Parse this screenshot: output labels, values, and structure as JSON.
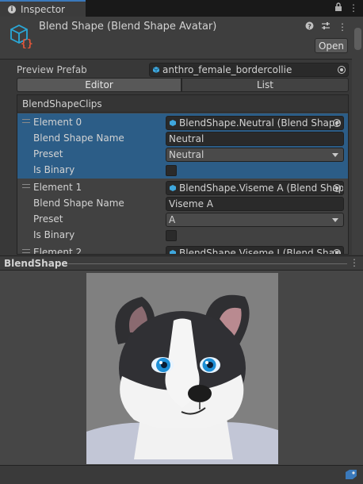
{
  "tab": {
    "label": "Inspector",
    "icon": "info-icon"
  },
  "header": {
    "title": "Blend Shape (Blend Shape Avatar)",
    "open_label": "Open",
    "tools": [
      "help-icon",
      "settings-icon",
      "more-icon"
    ]
  },
  "preview_prefab": {
    "label": "Preview Prefab",
    "value": "anthro_female_bordercollie"
  },
  "segments": {
    "editor": "Editor",
    "list": "List"
  },
  "clips": {
    "header": "BlendShapeClips",
    "elements": [
      {
        "title": "Element 0",
        "object": "BlendShape.Neutral (Blend Shape",
        "name_label": "Blend Shape Name",
        "name_value": "Neutral",
        "preset_label": "Preset",
        "preset_value": "Neutral",
        "binary_label": "Is Binary",
        "is_binary": false,
        "selected": true
      },
      {
        "title": "Element 1",
        "object": "BlendShape.Viseme A (Blend Shap",
        "name_label": "Blend Shape Name",
        "name_value": "Viseme A",
        "preset_label": "Preset",
        "preset_value": "A",
        "binary_label": "Is Binary",
        "is_binary": false,
        "selected": false
      },
      {
        "title": "Element 2",
        "object": "BlendShape.Viseme I (Blend Shap"
      }
    ]
  },
  "preview": {
    "title": "BlendShape",
    "bg_color": "#808080"
  },
  "colors": {
    "selected_row": "#2c5d87",
    "tab_accent": "#3a79bb",
    "asset_icon": "#2aa8d8",
    "asset_icon_braces": "#e0563a"
  }
}
